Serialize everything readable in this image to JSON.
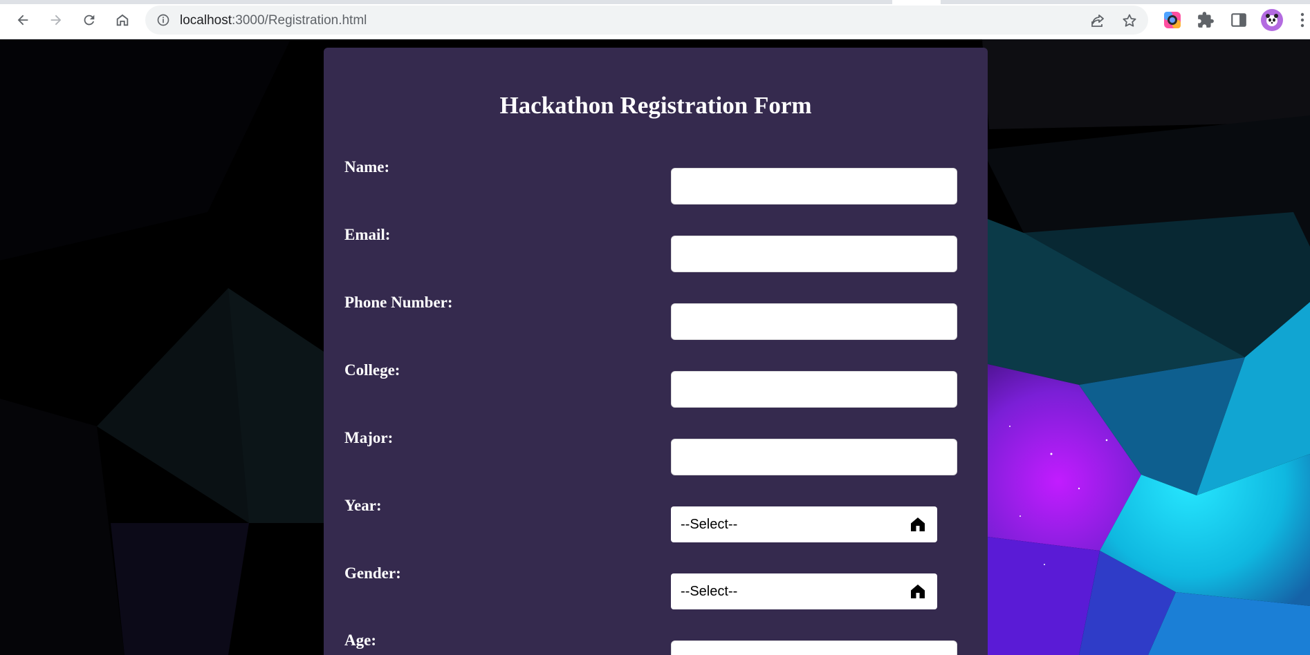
{
  "browser": {
    "url_host": "localhost",
    "url_path": ":3000/Registration.html"
  },
  "form": {
    "title": "Hackathon Registration Form",
    "fields": [
      {
        "label": "Name:",
        "type": "text",
        "value": ""
      },
      {
        "label": "Email:",
        "type": "text",
        "value": ""
      },
      {
        "label": "Phone Number:",
        "type": "text",
        "value": ""
      },
      {
        "label": "College:",
        "type": "text",
        "value": ""
      },
      {
        "label": "Major:",
        "type": "text",
        "value": ""
      },
      {
        "label": "Year:",
        "type": "select",
        "value": "--Select--"
      },
      {
        "label": "Gender:",
        "type": "select",
        "value": "--Select--"
      },
      {
        "label": "Age:",
        "type": "text",
        "value": ""
      }
    ]
  },
  "colors": {
    "card_background": "#352a4e",
    "page_background": "#000000"
  }
}
